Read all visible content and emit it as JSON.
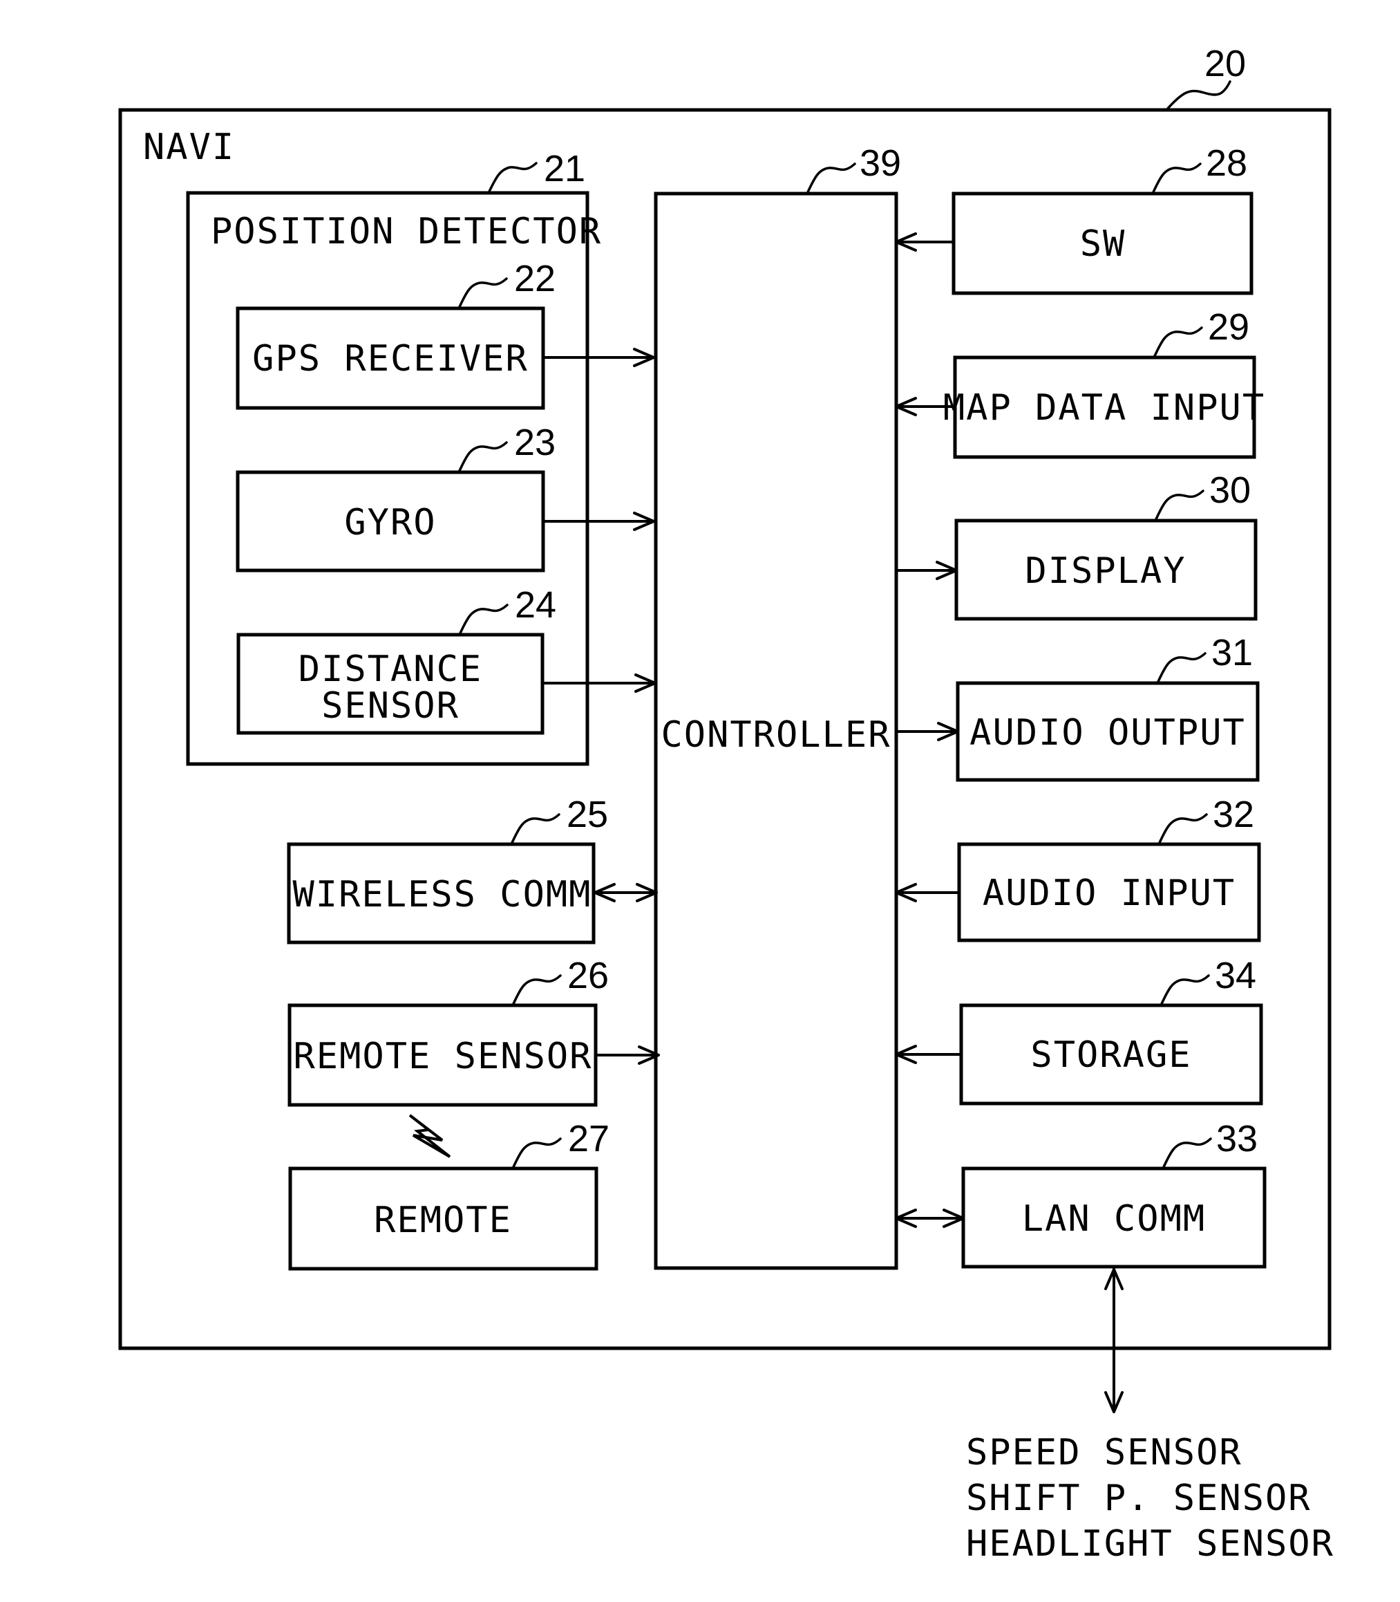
{
  "figure": {
    "system": {
      "label": "NAVI",
      "ref": "20"
    },
    "position_detector": {
      "label": "POSITION DETECTOR",
      "ref": "21"
    },
    "blocks": {
      "gps": {
        "label": "GPS RECEIVER",
        "ref": "22"
      },
      "gyro": {
        "label": "GYRO",
        "ref": "23"
      },
      "distance": {
        "label_line1": "DISTANCE",
        "label_line2": "SENSOR",
        "ref": "24"
      },
      "wireless": {
        "label": "WIRELESS COMM",
        "ref": "25"
      },
      "remote_sensor": {
        "label": "REMOTE SENSOR",
        "ref": "26"
      },
      "remote": {
        "label": "REMOTE",
        "ref": "27"
      },
      "controller": {
        "label": "CONTROLLER",
        "ref": "39"
      },
      "sw": {
        "label": "SW",
        "ref": "28"
      },
      "map_data": {
        "label": "MAP DATA INPUT",
        "ref": "29"
      },
      "display": {
        "label": "DISPLAY",
        "ref": "30"
      },
      "audio_out": {
        "label": "AUDIO OUTPUT",
        "ref": "31"
      },
      "audio_in": {
        "label": "AUDIO INPUT",
        "ref": "32"
      },
      "storage": {
        "label": "STORAGE",
        "ref": "34"
      },
      "lan": {
        "label": "LAN COMM",
        "ref": "33"
      }
    },
    "connections": [
      {
        "from": "GPS RECEIVER",
        "to": "CONTROLLER",
        "direction": "one-way"
      },
      {
        "from": "GYRO",
        "to": "CONTROLLER",
        "direction": "one-way"
      },
      {
        "from": "DISTANCE SENSOR",
        "to": "CONTROLLER",
        "direction": "one-way"
      },
      {
        "from": "WIRELESS COMM",
        "to": "CONTROLLER",
        "direction": "two-way"
      },
      {
        "from": "REMOTE SENSOR",
        "to": "CONTROLLER",
        "direction": "one-way"
      },
      {
        "from": "REMOTE",
        "to": "REMOTE SENSOR",
        "direction": "wireless"
      },
      {
        "from": "SW",
        "to": "CONTROLLER",
        "direction": "one-way"
      },
      {
        "from": "MAP DATA INPUT",
        "to": "CONTROLLER",
        "direction": "one-way"
      },
      {
        "from": "CONTROLLER",
        "to": "DISPLAY",
        "direction": "one-way"
      },
      {
        "from": "CONTROLLER",
        "to": "AUDIO OUTPUT",
        "direction": "one-way"
      },
      {
        "from": "AUDIO INPUT",
        "to": "CONTROLLER",
        "direction": "one-way"
      },
      {
        "from": "STORAGE",
        "to": "CONTROLLER",
        "direction": "one-way"
      },
      {
        "from": "LAN COMM",
        "to": "CONTROLLER",
        "direction": "two-way"
      },
      {
        "from": "LAN COMM",
        "to": "EXTERNAL SENSORS",
        "direction": "two-way"
      }
    ],
    "external_sensors": [
      "SPEED SENSOR",
      "SHIFT P. SENSOR",
      "HEADLIGHT SENSOR"
    ],
    "icons": {
      "wireless_link": "lightning-bolt-icon"
    }
  }
}
